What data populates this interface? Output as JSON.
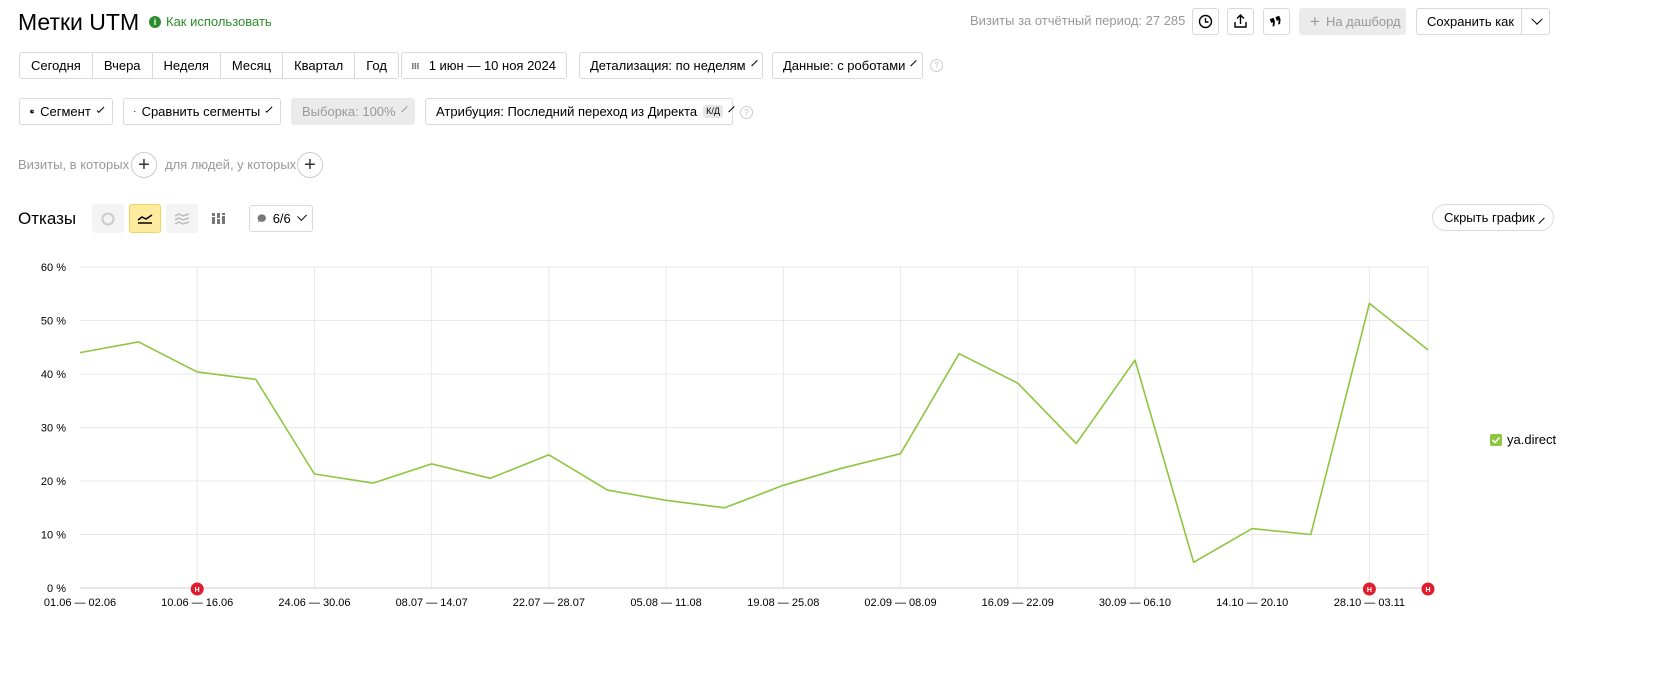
{
  "header": {
    "title": "Метки UTM",
    "help_link": "Как использовать",
    "visits_label": "Визиты за отчётный период: 27 285",
    "to_dashboard": "На дашборд",
    "save_as": "Сохранить как"
  },
  "period_presets": [
    "Сегодня",
    "Вчера",
    "Неделя",
    "Месяц",
    "Квартал",
    "Год"
  ],
  "date_range": "1 июн — 10 ноя 2024",
  "detail_select": "Детализация: по неделям",
  "data_select": "Данные: с роботами",
  "segment_button": "Сегмент",
  "compare_button": "Сравнить сегменты",
  "sample_button": "Выборка: 100%",
  "attribution_button": "Атрибуция: Последний переход из Директа",
  "attribution_badge": "К/Д",
  "filters": {
    "visits_label": "Визиты, в которых",
    "people_label": "для людей, у которых"
  },
  "chart_header": {
    "metric_title": "Отказы",
    "annotations_count": "6/6",
    "hide_chart": "Скрыть график"
  },
  "colors": {
    "accent_green": "#8dc63f",
    "active_view": "#ffeba0",
    "marker_red": "#e01d2d",
    "link_green": "#2c8d2c"
  },
  "chart_data": {
    "type": "line",
    "x": [
      "01.06 — 02.06",
      "03.06 — 09.06",
      "10.06 — 16.06",
      "17.06 — 23.06",
      "24.06 — 30.06",
      "01.07 — 07.07",
      "08.07 — 14.07",
      "15.07 — 21.07",
      "22.07 — 28.07",
      "29.07 — 04.08",
      "05.08 — 11.08",
      "12.08 — 18.08",
      "19.08 — 25.08",
      "26.08 — 01.09",
      "02.09 — 08.09",
      "09.09 — 15.09",
      "16.09 — 22.09",
      "23.09 — 29.09",
      "30.09 — 06.10",
      "07.10 — 13.10",
      "14.10 — 20.10",
      "21.10 — 27.10",
      "28.10 — 03.11",
      "04.11 — 10.11"
    ],
    "x_tick_labels": [
      "01.06 — 02.06",
      "10.06 — 16.06",
      "24.06 — 30.06",
      "08.07 — 14.07",
      "22.07 — 28.07",
      "05.08 — 11.08",
      "19.08 — 25.08",
      "02.09 — 08.09",
      "16.09 — 22.09",
      "30.09 — 06.10",
      "14.10 — 20.10",
      "28.10 — 03.11"
    ],
    "series": [
      {
        "name": "ya.direct",
        "values": [
          44,
          46,
          40.4,
          39,
          21.3,
          19.6,
          23.2,
          20.5,
          24.9,
          18.3,
          16.4,
          15,
          19.2,
          22.4,
          25.1,
          43.8,
          38.3,
          27,
          42.6,
          4.8,
          11.1,
          10,
          53.2,
          44.5
        ]
      }
    ],
    "y_tick_labels": [
      "0 %",
      "10 %",
      "20 %",
      "30 %",
      "40 %",
      "50 %",
      "60 %"
    ],
    "ylim": [
      0,
      60
    ],
    "grid": true,
    "legend": "right",
    "markers": [
      {
        "x": "10.06 — 16.06",
        "label": "Н"
      },
      {
        "x": "28.10 — 03.11",
        "label": "Н"
      },
      {
        "x": "04.11 — 10.11",
        "label": "Н"
      }
    ]
  }
}
